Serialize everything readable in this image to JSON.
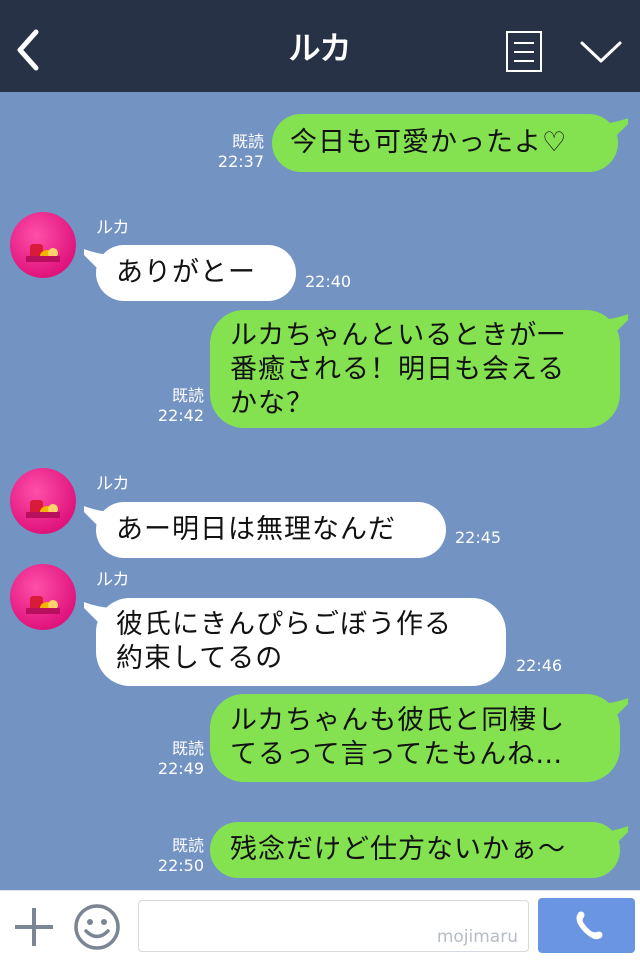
{
  "header": {
    "title": "ルカ",
    "back_icon": "chevron-left-icon",
    "menu_icon": "notes-icon",
    "expand_icon": "chevron-down-icon"
  },
  "messages": [
    {
      "side": "out",
      "text": "今日も可愛かったよ♡",
      "read_label": "既読",
      "time": "22:37"
    },
    {
      "side": "in",
      "sender": "ルカ",
      "text": "ありがとー",
      "time": "22:40"
    },
    {
      "side": "out",
      "line1": "ルカちゃんといるときが一",
      "line2": "番癒される！明日も会える",
      "line3": "かな？",
      "read_label": "既読",
      "time": "22:42"
    },
    {
      "side": "in",
      "sender": "ルカ",
      "text": "あー明日は無理なんだ",
      "time": "22:45"
    },
    {
      "side": "in",
      "sender": "ルカ",
      "line1": "彼氏にきんぴらごぼう作る",
      "line2": "約束してるの",
      "time": "22:46"
    },
    {
      "side": "out",
      "line1": "ルカちゃんも彼氏と同棲し",
      "line2": "てるって言ってたもんね…",
      "read_label": "既読",
      "time": "22:49"
    },
    {
      "side": "out",
      "text": "残念だけど仕方ないかぁ～",
      "read_label": "既読",
      "time": "22:50"
    }
  ],
  "footer": {
    "plus_icon": "plus-icon",
    "emoji_icon": "smiley-icon",
    "send_icon": "phone-icon",
    "watermark": "mojimaru"
  },
  "colors": {
    "header_bg": "#273246",
    "chat_bg": "#7393c3",
    "outgoing_bubble": "#84e251",
    "incoming_bubble": "#ffffff",
    "send_button": "#6a95e2"
  }
}
